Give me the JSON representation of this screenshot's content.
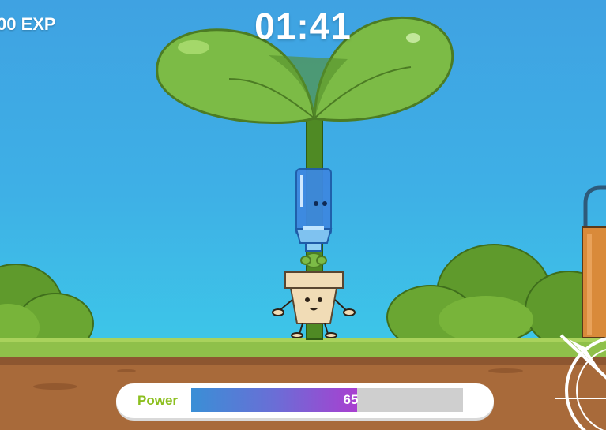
{
  "hud": {
    "exp_text": "00 EXP",
    "timer": "01:41"
  },
  "power": {
    "label": "Power",
    "value": 65,
    "value_text": "65",
    "fill_fraction": 0.61,
    "colors": {
      "start": "#3a8fd6",
      "end": "#a93fd0",
      "label": "#8cbf1f"
    }
  },
  "scene": {
    "sky_color": "#3fa2e2",
    "grass_color": "#8fc04a",
    "soil_color": "#a86a3a",
    "icons": [
      "sprout-icon",
      "water-bottle-icon",
      "flower-pot-character-icon",
      "bush-icon",
      "watering-can-icon",
      "compass-icon"
    ]
  }
}
